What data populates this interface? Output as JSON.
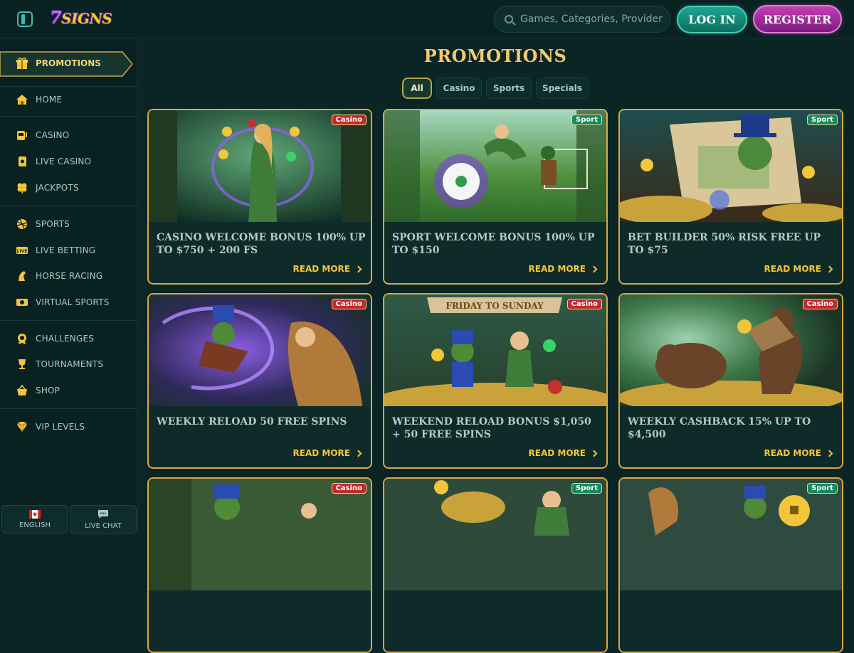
{
  "header": {
    "logo_text": "7SIGNS",
    "search_placeholder": "Games, Categories, Providers",
    "login_label": "LOG IN",
    "register_label": "REGISTER"
  },
  "sidebar": {
    "promotions_label": "PROMOTIONS",
    "items": [
      {
        "label": "HOME",
        "icon": "home-icon"
      },
      {
        "label": "CASINO",
        "icon": "slot-machine-icon"
      },
      {
        "label": "LIVE CASINO",
        "icon": "card-icon"
      },
      {
        "label": "JACKPOTS",
        "icon": "clover-icon"
      },
      {
        "label": "SPORTS",
        "icon": "ball-icon"
      },
      {
        "label": "LIVE BETTING",
        "icon": "live-icon"
      },
      {
        "label": "HORSE RACING",
        "icon": "horse-icon"
      },
      {
        "label": "VIRTUAL SPORTS",
        "icon": "virtual-icon"
      },
      {
        "label": "CHALLENGES",
        "icon": "badge-icon"
      },
      {
        "label": "TOURNAMENTS",
        "icon": "trophy-icon"
      },
      {
        "label": "SHOP",
        "icon": "basket-icon"
      },
      {
        "label": "VIP LEVELS",
        "icon": "diamond-icon"
      }
    ],
    "language_label": "ENGLISH",
    "live_chat_label": "LIVE CHAT"
  },
  "main": {
    "title": "PROMOTIONS",
    "filters": [
      "All",
      "Casino",
      "Sports",
      "Specials"
    ],
    "cards": [
      {
        "badge": "Casino",
        "title": "CASINO WELCOME BONUS 100% UP TO $750 + 200 FS",
        "more": "READ MORE"
      },
      {
        "badge": "Sport",
        "title": "SPORT WELCOME BONUS 100% UP TO $150",
        "more": "READ MORE"
      },
      {
        "badge": "Sport",
        "title": "BET BUILDER 50% RISK FREE UP TO $75",
        "more": "READ MORE"
      },
      {
        "badge": "Casino",
        "title": "WEEKLY RELOAD 50 FREE SPINS",
        "more": "READ MORE"
      },
      {
        "badge": "Casino",
        "title": "WEEKEND RELOAD BONUS $1,050 + 50 FREE SPINS",
        "more": "READ MORE",
        "banner": "FRIDAY TO SUNDAY"
      },
      {
        "badge": "Casino",
        "title": "WEEKLY CASHBACK 15% UP TO $4,500",
        "more": "READ MORE"
      },
      {
        "badge": "Casino",
        "title": "",
        "more": ""
      },
      {
        "badge": "Sport",
        "title": "",
        "more": ""
      },
      {
        "badge": "Sport",
        "title": "",
        "more": ""
      }
    ]
  },
  "colors": {
    "accent_gold": "#f3c63a",
    "teal_button": "#1fa590",
    "magenta_button": "#c43fb4",
    "background": "#0b2424"
  }
}
